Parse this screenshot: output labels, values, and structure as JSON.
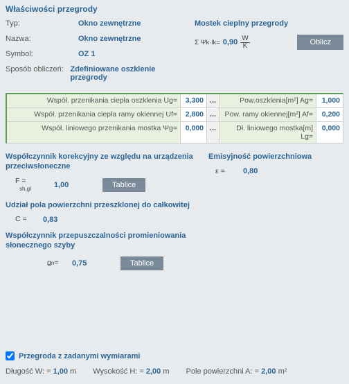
{
  "header": "Właściwości przegrody",
  "props": {
    "type_label": "Typ:",
    "type_value": "Okno zewnętrzne",
    "name_label": "Nazwa:",
    "name_value": "Okno zewnętrzne",
    "symbol_label": "Symbol:",
    "symbol_value": "OZ 1",
    "calc_label": "Sposób obliczeń:",
    "calc_value": "Zdefiniowane oszklenie przegrody"
  },
  "bridge": {
    "title": "Mostek cieplny przegrody",
    "formula_sym": "Σ Ψk·lk=",
    "value": "0,90",
    "unit_top": "W",
    "unit_bot": "K",
    "btn": "Oblicz"
  },
  "table": [
    {
      "l1": "Współ. przenikania ciepła oszklenia Ug=",
      "v1": "3,300",
      "l2": "Pow.oszklenia[m²] Ag=",
      "v2": "1,000"
    },
    {
      "l1": "Współ. przenikania ciepła ramy okiennej Uf=",
      "v1": "2,800",
      "l2": "Pow. ramy okiennej[m²] Af=",
      "v2": "0,200"
    },
    {
      "l1": "Współ. liniowego przenikania mostka Ψg=",
      "v1": "0,000",
      "l2": "Dł. liniowego mostka[m] Lg=",
      "v2": "0,000"
    }
  ],
  "mid": {
    "korr_title": "Współczynnik korekcyjny ze względu na urządzenia przeciwsłoneczne",
    "fsh_sym_top": "F   =",
    "fsh_sym_bot": "sh,gl",
    "fsh_val": "1,00",
    "tablice": "Tablice",
    "udzial_title": "Udział pola powierzchni przeszklonej do całkowitej",
    "c_sym": "C  =",
    "c_val": "0,83",
    "gn_title": "Współczynnik przepuszczalności promieniowania słonecznego szyby",
    "gn_sym": "gn=",
    "gn_val": "0,75",
    "emis_title": "Emisyjność powierzchniowa",
    "eps_sym": "ε  =",
    "eps_val": "0,80"
  },
  "bottom": {
    "chk_label": "Przegroda z zadanymi wymiarami",
    "dim_w_label": "Długość W: =",
    "dim_w_val": "1,00",
    "dim_w_unit": "m",
    "dim_h_label": "Wysokość H: =",
    "dim_h_val": "2,00",
    "dim_h_unit": "m",
    "dim_a_label": "Pole powierzchni A: =",
    "dim_a_val": "2,00",
    "dim_a_unit": "m²"
  }
}
